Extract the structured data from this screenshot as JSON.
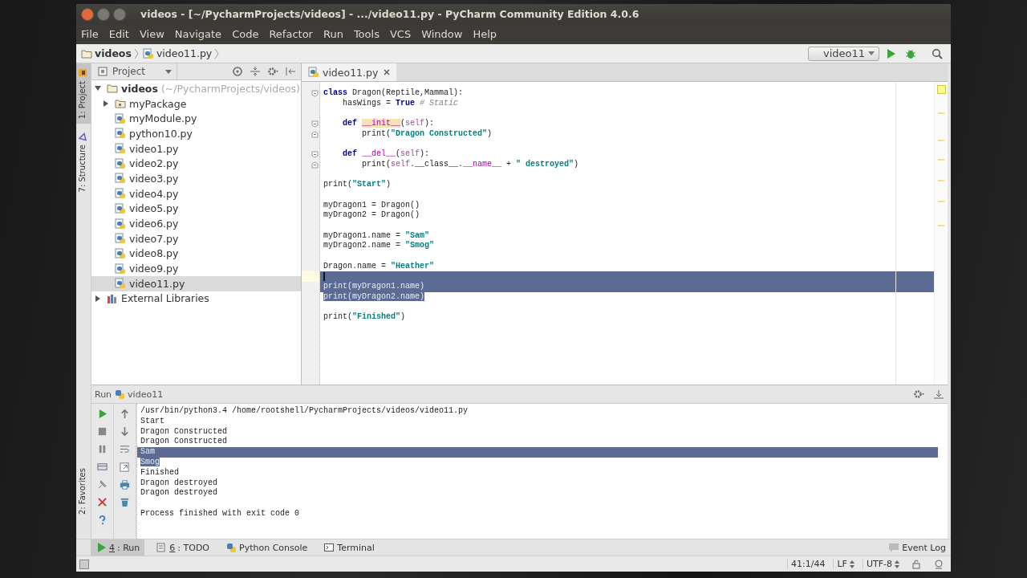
{
  "window": {
    "title": "videos - [~/PycharmProjects/videos] - .../video11.py - PyCharm Community Edition 4.0.6"
  },
  "menu": [
    "File",
    "Edit",
    "View",
    "Navigate",
    "Code",
    "Refactor",
    "Run",
    "Tools",
    "VCS",
    "Window",
    "Help"
  ],
  "breadcrumbs": [
    {
      "kind": "folder",
      "label": "videos"
    },
    {
      "kind": "file",
      "label": "video11.py"
    }
  ],
  "run_config": {
    "label": "video11"
  },
  "side_tabs": [
    {
      "label": "1: Project",
      "selected": true,
      "kind": "project"
    },
    {
      "label": "7: Structure",
      "selected": false,
      "kind": "structure"
    }
  ],
  "favorites_tab": {
    "label": "2: Favorites"
  },
  "project_panel": {
    "title": "Project",
    "tree": [
      {
        "label": "videos",
        "path": "(~/PycharmProjects/videos)",
        "kind": "folder",
        "expanded": true,
        "selected": false,
        "children": [
          {
            "label": "myPackage",
            "kind": "package",
            "expanded": false,
            "selected": false
          },
          {
            "label": "myModule.py",
            "kind": "file",
            "selected": false
          },
          {
            "label": "python10.py",
            "kind": "file",
            "selected": false
          },
          {
            "label": "video1.py",
            "kind": "file",
            "selected": false
          },
          {
            "label": "video2.py",
            "kind": "file",
            "selected": false
          },
          {
            "label": "video3.py",
            "kind": "file",
            "selected": false
          },
          {
            "label": "video4.py",
            "kind": "file",
            "selected": false
          },
          {
            "label": "video5.py",
            "kind": "file",
            "selected": false
          },
          {
            "label": "video6.py",
            "kind": "file",
            "selected": false
          },
          {
            "label": "video7.py",
            "kind": "file",
            "selected": false
          },
          {
            "label": "video8.py",
            "kind": "file",
            "selected": false
          },
          {
            "label": "video9.py",
            "kind": "file",
            "selected": false
          },
          {
            "label": "video11.py",
            "kind": "file",
            "selected": true
          }
        ]
      },
      {
        "label": "External Libraries",
        "kind": "library",
        "expanded": false,
        "selected": false
      }
    ]
  },
  "editor_tabs": [
    {
      "label": "video11.py",
      "selected": true
    }
  ],
  "code": [
    {
      "kind": "code",
      "fold_start": true,
      "tokens": [
        {
          "kind": "keyword",
          "text": "class"
        },
        {
          "kind": "plain",
          "text": " Dragon(Reptile,Mammal):"
        }
      ]
    },
    {
      "kind": "code",
      "tokens": [
        {
          "kind": "plain",
          "text": "    hasWings = "
        },
        {
          "kind": "keyword",
          "text": "True"
        },
        {
          "kind": "comment",
          "text": " # Static"
        }
      ]
    },
    {
      "kind": "blank"
    },
    {
      "kind": "code",
      "fold_start": true,
      "tokens": [
        {
          "kind": "keyword",
          "text": "    def "
        },
        {
          "kind": "highlighted",
          "text": "__init__"
        },
        {
          "kind": "plain",
          "text": "("
        },
        {
          "kind": "self",
          "text": "self"
        },
        {
          "kind": "plain",
          "text": "):"
        }
      ]
    },
    {
      "kind": "code",
      "fold_end": true,
      "tokens": [
        {
          "kind": "plain",
          "text": "        print("
        },
        {
          "kind": "string",
          "text": "\"Dragon Constructed\""
        },
        {
          "kind": "plain",
          "text": ")"
        }
      ]
    },
    {
      "kind": "blank"
    },
    {
      "kind": "code",
      "fold_start": true,
      "tokens": [
        {
          "kind": "keyword",
          "text": "    def "
        },
        {
          "kind": "magic",
          "text": "__del__"
        },
        {
          "kind": "plain",
          "text": "("
        },
        {
          "kind": "self",
          "text": "self"
        },
        {
          "kind": "plain",
          "text": "):"
        }
      ]
    },
    {
      "kind": "code",
      "fold_end": true,
      "tokens": [
        {
          "kind": "plain",
          "text": "        print("
        },
        {
          "kind": "self",
          "text": "self"
        },
        {
          "kind": "plain",
          "text": ".__class__."
        },
        {
          "kind": "magic",
          "text": "__name__"
        },
        {
          "kind": "plain",
          "text": " + "
        },
        {
          "kind": "string",
          "text": "\" destroyed\""
        },
        {
          "kind": "plain",
          "text": ")"
        }
      ]
    },
    {
      "kind": "blank"
    },
    {
      "kind": "code",
      "tokens": [
        {
          "kind": "plain",
          "text": "print("
        },
        {
          "kind": "string",
          "text": "\"Start\""
        },
        {
          "kind": "plain",
          "text": ")"
        }
      ]
    },
    {
      "kind": "blank"
    },
    {
      "kind": "code",
      "tokens": [
        {
          "kind": "plain",
          "text": "myDragon1 = Dragon()"
        }
      ]
    },
    {
      "kind": "code",
      "tokens": [
        {
          "kind": "plain",
          "text": "myDragon2 = Dragon()"
        }
      ]
    },
    {
      "kind": "blank"
    },
    {
      "kind": "code",
      "tokens": [
        {
          "kind": "plain",
          "text": "myDragon1.name = "
        },
        {
          "kind": "string",
          "text": "\"Sam\""
        }
      ]
    },
    {
      "kind": "code",
      "tokens": [
        {
          "kind": "plain",
          "text": "myDragon2.name = "
        },
        {
          "kind": "string",
          "text": "\"Smog\""
        }
      ]
    },
    {
      "kind": "blank"
    },
    {
      "kind": "code",
      "tokens": [
        {
          "kind": "plain",
          "text": "Dragon.name = "
        },
        {
          "kind": "string",
          "text": "\"Heather\""
        }
      ]
    },
    {
      "kind": "blank",
      "current": true,
      "selected": true,
      "whole_line": true
    },
    {
      "kind": "code",
      "selected": true,
      "whole_line": true,
      "tokens": [
        {
          "kind": "plain",
          "text": "print(myDragon1.name)"
        }
      ]
    },
    {
      "kind": "code",
      "selected": true,
      "whole_line": false,
      "tokens": [
        {
          "kind": "plain",
          "text": "print(myDragon2.name)"
        }
      ]
    },
    {
      "kind": "blank"
    },
    {
      "kind": "code",
      "tokens": [
        {
          "kind": "plain",
          "text": "print("
        },
        {
          "kind": "string",
          "text": "\"Finished\""
        },
        {
          "kind": "plain",
          "text": ")"
        }
      ]
    }
  ],
  "run_panel": {
    "label": "Run",
    "config": "video11",
    "output": [
      {
        "text": "/usr/bin/python3.4 /home/rootshell/PycharmProjects/videos/video11.py"
      },
      {
        "text": "Start"
      },
      {
        "text": "Dragon Constructed"
      },
      {
        "text": "Dragon Constructed"
      },
      {
        "text": "Sam",
        "selected": true,
        "whole_line": true
      },
      {
        "text": "Smog",
        "selected": true,
        "whole_line": false
      },
      {
        "text": "Finished"
      },
      {
        "text": "Dragon destroyed"
      },
      {
        "text": "Dragon destroyed"
      },
      {
        "text": "Process finished with exit code 0",
        "gap_before": true
      }
    ]
  },
  "bottom_tabs": [
    {
      "kind": "run",
      "number": "4",
      "label": ": Run",
      "selected": true
    },
    {
      "kind": "todo",
      "number": "6",
      "label": ": TODO",
      "selected": false
    },
    {
      "kind": "console",
      "label": "Python Console",
      "selected": false
    },
    {
      "kind": "terminal",
      "label": "Terminal",
      "selected": false
    }
  ],
  "event_log": "Event Log",
  "status_bar": {
    "position": "41:1/44",
    "line_separator": "LF",
    "encoding": "UTF-8"
  }
}
